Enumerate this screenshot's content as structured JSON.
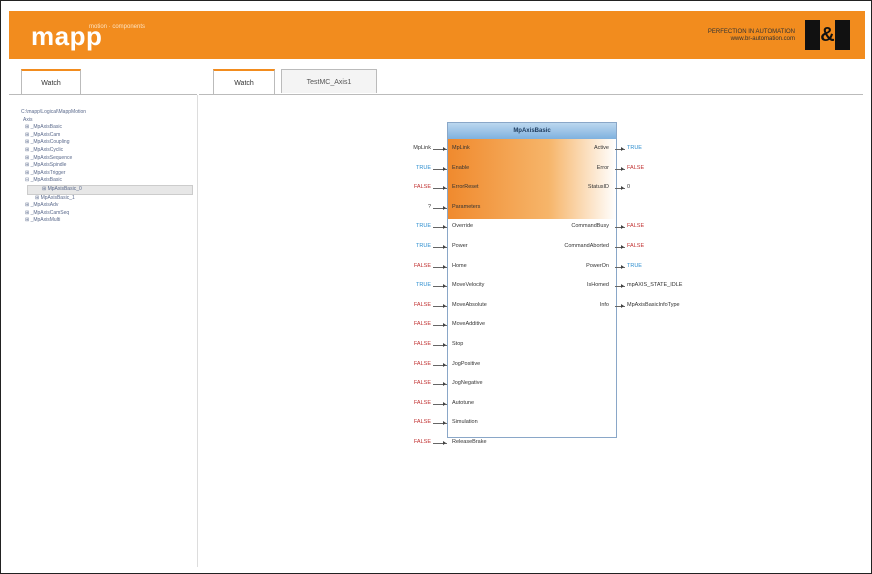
{
  "header": {
    "logo": "mapp",
    "logo_sub": "motion · components",
    "brand_line1": "PERFECTION IN AUTOMATION",
    "brand_line2": "www.br-automation.com",
    "brand_mark_left": "B",
    "brand_mark_amp": "&",
    "brand_mark_right": "R"
  },
  "sidebar_tab": "Watch",
  "main_tabs": [
    "Watch",
    "TestMC_Axis1"
  ],
  "tree": {
    "root": "C:\\mapp\\Logical\\MappMotion",
    "items": [
      "Axis",
      "⊞ _MpAxisBasic",
      "⊞ _MpAxisCam",
      "⊞ _MpAxisCoupling",
      "⊞ _MpAxisCyclic",
      "⊞ _MpAxisSequence",
      "⊞ _MpAxisSpindle",
      "⊞ _MpAxisTrigger",
      "⊟ _MpAxisBasic",
      "⊞ MpAxisBasic_0",
      "⊞ MpAxisBasic_1",
      "⊞ _MpAxisAdv",
      "⊞ _MpAxisCamSeq",
      "⊞ _MpAxisMulti"
    ]
  },
  "fb": {
    "title": "MpAxisBasic",
    "left_pins": [
      "MpLink",
      "Enable",
      "ErrorReset",
      "Parameters",
      "Override",
      "Power",
      "Home",
      "MoveVelocity",
      "MoveAbsolute",
      "MoveAdditive",
      "Stop",
      "JogPositive",
      "JogNegative",
      "Autotune",
      "Simulation",
      "ReleaseBrake"
    ],
    "left_vals": [
      "MpLink",
      "TRUE",
      "FALSE",
      "?",
      "TRUE",
      "TRUE",
      "FALSE",
      "TRUE",
      "FALSE",
      "FALSE",
      "FALSE",
      "FALSE",
      "FALSE",
      "FALSE",
      "FALSE",
      "FALSE"
    ],
    "right_pins": [
      "Active",
      "Error",
      "StatusID",
      "CommandBusy",
      "CommandAborted",
      "PowerOn",
      "IsHomed",
      "Info"
    ],
    "right_vals": [
      "TRUE",
      "FALSE",
      "0",
      "FALSE",
      "FALSE",
      "TRUE",
      "mpAXIS_STATE_IDLE",
      "MpAxisBasicInfoType"
    ]
  },
  "colors": {
    "accent": "#f28c1e",
    "true_color": "#2f8fd0",
    "false_color": "#c03030",
    "default_color": "#333333"
  }
}
